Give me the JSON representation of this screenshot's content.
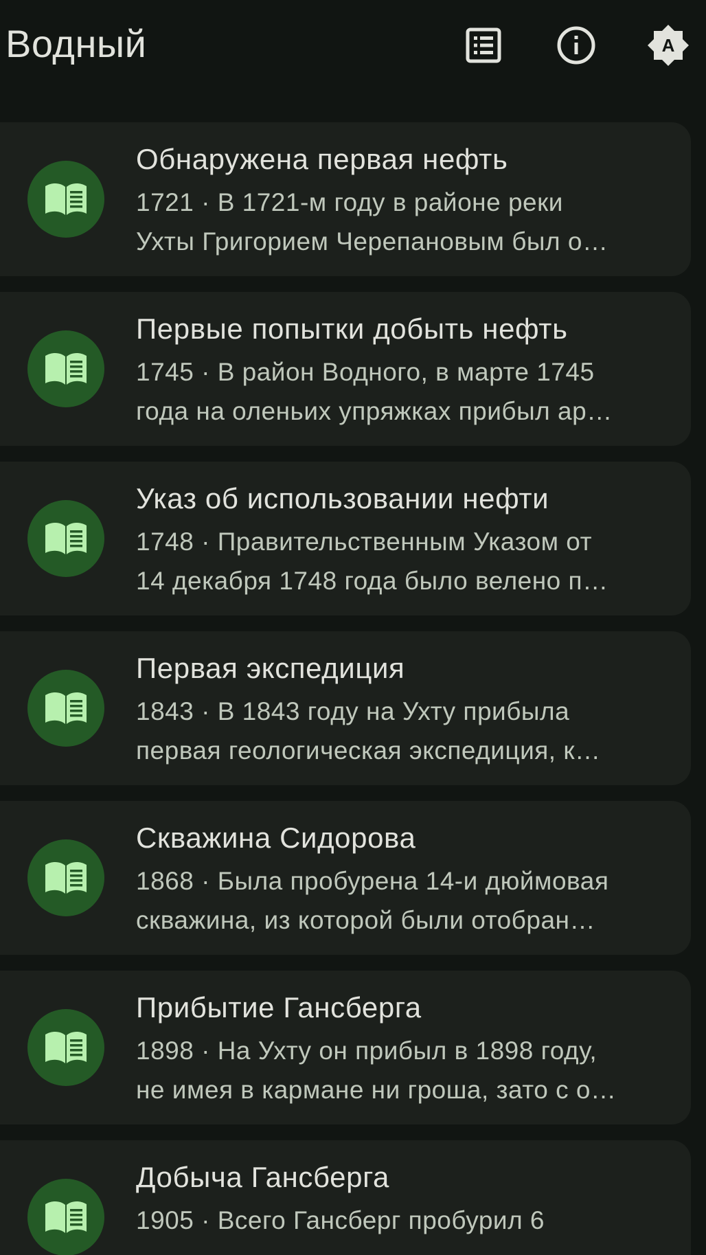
{
  "app_bar": {
    "title": "Водный",
    "actions": [
      {
        "name": "list-icon"
      },
      {
        "name": "info-icon"
      },
      {
        "name": "brightness-auto-icon",
        "glyph": "A"
      }
    ]
  },
  "colors": {
    "background": "#111512",
    "card": "#1c201c",
    "avatar": "#245a26",
    "icon_accent": "#b7f0ae",
    "title_text": "#e2e3dd",
    "secondary_text": "#c0c8bc"
  },
  "events": [
    {
      "title": "Обнаружена первая нефть",
      "line1": "1721 · В 1721-м году в районе реки",
      "line2": "Ухты Григорием Черепановым был о…"
    },
    {
      "title": "Первые попытки добыть нефть",
      "line1": "1745 · В район Водного, в марте 1745",
      "line2": "года на оленьих упряжках прибыл ар…"
    },
    {
      "title": "Указ об использовании нефти",
      "line1": "1748 · Правительственным Указом от",
      "line2": "14 декабря 1748 года было велено п…"
    },
    {
      "title": "Первая экспедиция",
      "line1": "1843 · В 1843 году на Ухту прибыла",
      "line2": "первая геологическая экспедиция, к…"
    },
    {
      "title": "Скважина Сидорова",
      "line1": "1868 · Была пробурена 14-и дюймовая",
      "line2": "скважина, из которой были отобран…"
    },
    {
      "title": "Прибытие Гансберга",
      "line1": "1898 · На Ухту он прибыл в 1898 году,",
      "line2": "не имея в кармане ни гроша, зато с о…"
    },
    {
      "title": "Добыча Гансберга",
      "line1": "1905 · Всего Гансберг пробурил 6",
      "line2": ""
    }
  ]
}
